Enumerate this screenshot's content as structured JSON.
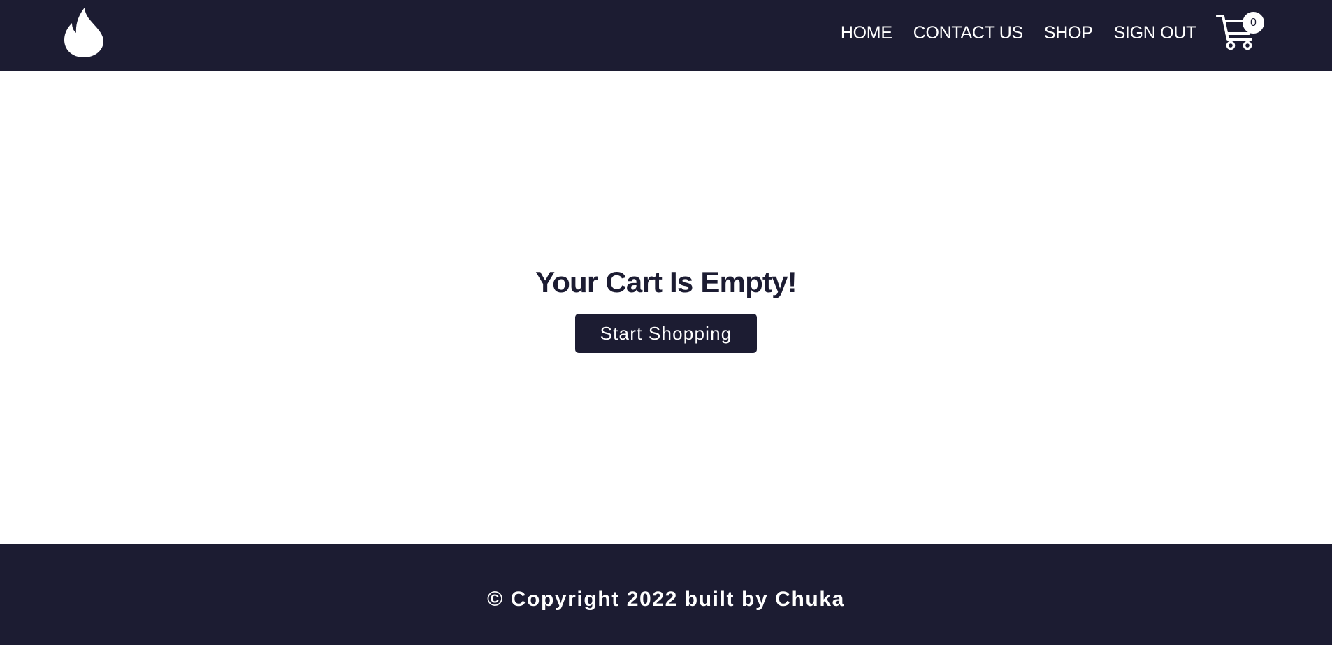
{
  "header": {
    "logo_icon": "flame-icon",
    "nav": [
      {
        "label": "HOME"
      },
      {
        "label": "CONTACT US"
      },
      {
        "label": "SHOP"
      },
      {
        "label": "SIGN OUT"
      }
    ],
    "cart": {
      "icon": "shopping-cart-icon",
      "count": "0"
    }
  },
  "main": {
    "empty_message": "Your Cart Is Empty!",
    "cta_label": "Start Shopping"
  },
  "footer": {
    "copyright": "© Copyright 2022 built by Chuka"
  },
  "colors": {
    "primary_dark": "#1c1c32",
    "background": "#ffffff",
    "text_light": "#ffffff"
  }
}
